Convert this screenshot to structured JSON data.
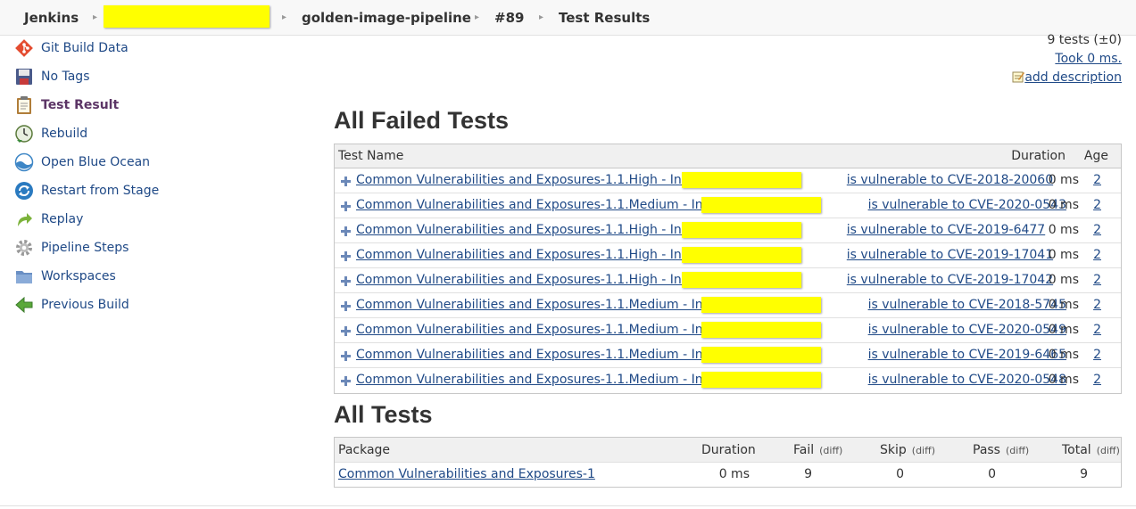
{
  "breadcrumb": {
    "items": [
      {
        "label": "Jenkins"
      },
      {
        "label": ""
      },
      {
        "label": "golden-image-pipeline"
      },
      {
        "label": "#89"
      },
      {
        "label": "Test Results"
      }
    ],
    "separator": "›"
  },
  "sidebar": {
    "items": [
      {
        "label": "Git Build Data",
        "icon": "git-icon"
      },
      {
        "label": "No Tags",
        "icon": "floppy-disk-icon"
      },
      {
        "label": "Test Result",
        "icon": "clipboard-icon",
        "active": true
      },
      {
        "label": "Rebuild",
        "icon": "clock-rebuild-icon"
      },
      {
        "label": "Open Blue Ocean",
        "icon": "blue-ocean-icon"
      },
      {
        "label": "Restart from Stage",
        "icon": "restart-icon"
      },
      {
        "label": "Replay",
        "icon": "replay-arrow-icon"
      },
      {
        "label": "Pipeline Steps",
        "icon": "gear-icon"
      },
      {
        "label": "Workspaces",
        "icon": "folder-icon"
      },
      {
        "label": "Previous Build",
        "icon": "left-arrow-icon"
      }
    ]
  },
  "summary": {
    "tests_count": "9 tests (±0)",
    "took": "Took 0 ms.",
    "add_description": "add description"
  },
  "failed_tests": {
    "title": "All Failed Tests",
    "columns": {
      "name": "Test Name",
      "duration": "Duration",
      "age": "Age"
    },
    "rows": [
      {
        "prefix": "Common Vulnerabilities and Exposures-1.1.High - Instance ",
        "suffix": "is vulnerable to CVE-2018-20060",
        "duration": "0 ms",
        "age": "2"
      },
      {
        "prefix": "Common Vulnerabilities and Exposures-1.1.Medium - Instance ",
        "suffix": "is vulnerable to CVE-2020-0543",
        "duration": "0 ms",
        "age": "2"
      },
      {
        "prefix": "Common Vulnerabilities and Exposures-1.1.High - Instance ",
        "suffix": "is vulnerable to CVE-2019-6477",
        "duration": "0 ms",
        "age": "2"
      },
      {
        "prefix": "Common Vulnerabilities and Exposures-1.1.High - Instance ",
        "suffix": "is vulnerable to CVE-2019-17041",
        "duration": "0 ms",
        "age": "2"
      },
      {
        "prefix": "Common Vulnerabilities and Exposures-1.1.High - Instance ",
        "suffix": "is vulnerable to CVE-2019-17042",
        "duration": "0 ms",
        "age": "2"
      },
      {
        "prefix": "Common Vulnerabilities and Exposures-1.1.Medium - Instance ",
        "suffix": "is vulnerable to CVE-2018-5745",
        "duration": "0 ms",
        "age": "2"
      },
      {
        "prefix": "Common Vulnerabilities and Exposures-1.1.Medium - Instance ",
        "suffix": "is vulnerable to CVE-2020-0549",
        "duration": "0 ms",
        "age": "2"
      },
      {
        "prefix": "Common Vulnerabilities and Exposures-1.1.Medium - Instance ",
        "suffix": "is vulnerable to CVE-2019-6465",
        "duration": "0 ms",
        "age": "2"
      },
      {
        "prefix": "Common Vulnerabilities and Exposures-1.1.Medium - Instance ",
        "suffix": "is vulnerable to CVE-2020-0548",
        "duration": "0 ms",
        "age": "2"
      }
    ]
  },
  "all_tests": {
    "title": "All Tests",
    "columns": {
      "package": "Package",
      "duration": "Duration",
      "fail": "Fail",
      "skip": "Skip",
      "pass": "Pass",
      "total": "Total",
      "diff": "(diff)"
    },
    "rows": [
      {
        "package": "Common Vulnerabilities and Exposures-1",
        "duration": "0 ms",
        "fail": "9",
        "skip": "0",
        "pass": "0",
        "total": "9"
      }
    ]
  },
  "colors": {
    "link": "#204a87",
    "redaction": "#ffff00",
    "active_sidebar": "#5c3566",
    "header_bg": "#f0f0f0"
  }
}
